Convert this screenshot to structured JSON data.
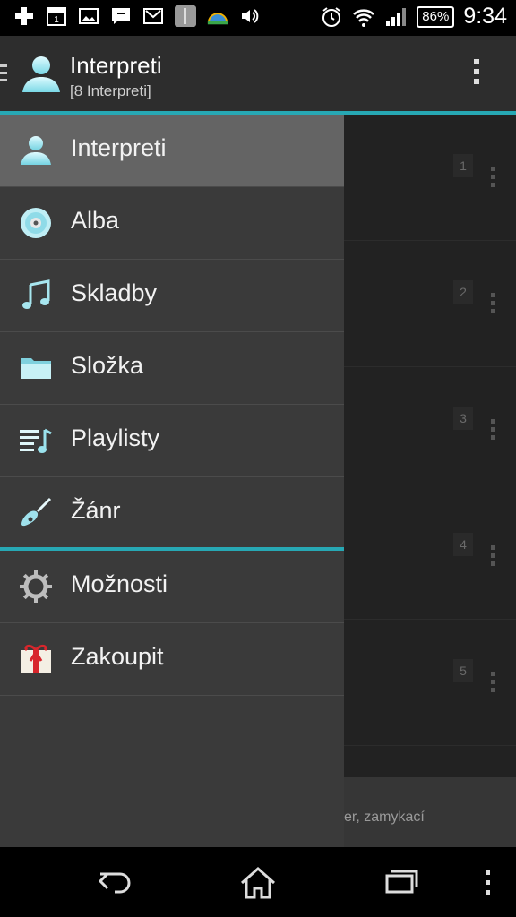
{
  "status_bar": {
    "battery": "86%",
    "time": "9:34",
    "calendar_day": "1",
    "icons": [
      "add-icon",
      "calendar-icon",
      "image-icon",
      "message-icon",
      "gmail-icon",
      "app-icon",
      "weather-icon",
      "volume-icon",
      "alarm-icon",
      "wifi-icon",
      "signal-icon",
      "battery-icon"
    ]
  },
  "action_bar": {
    "title": "Interpreti",
    "subtitle": "[8 Interpreti]"
  },
  "drawer": {
    "items": [
      {
        "label": "Interpreti",
        "icon": "artist-icon",
        "active": true
      },
      {
        "label": "Alba",
        "icon": "album-disc-icon"
      },
      {
        "label": "Skladby",
        "icon": "music-note-icon"
      },
      {
        "label": "Složka",
        "icon": "folder-icon"
      },
      {
        "label": "Playlisty",
        "icon": "playlist-icon"
      },
      {
        "label": "Žánr",
        "icon": "guitar-icon"
      }
    ],
    "secondary_items": [
      {
        "label": "Možnosti",
        "icon": "gear-icon"
      },
      {
        "label": "Zakoupit",
        "icon": "gift-icon"
      }
    ]
  },
  "background_list": {
    "badges": [
      "1",
      "2",
      "3",
      "4",
      "5"
    ],
    "footer_text": "er, zamykací"
  },
  "colors": {
    "accent": "#27a8b4",
    "drawer_bg": "#3a3a3a",
    "active_item": "#646464"
  },
  "nav_bar": {
    "buttons": [
      "back-icon",
      "home-icon",
      "recent-apps-icon",
      "menu-icon"
    ]
  }
}
